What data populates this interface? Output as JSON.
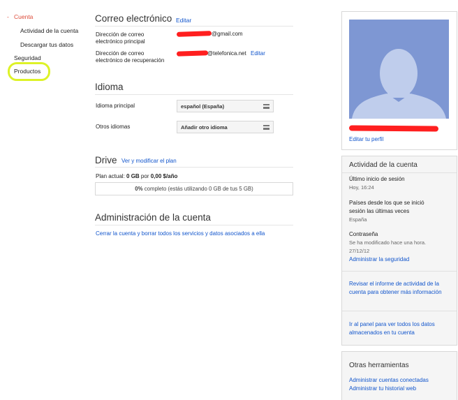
{
  "nav": {
    "account_bullet": "-",
    "account": "Cuenta",
    "activity": "Actividad de la cuenta",
    "download": "Descargar tus datos",
    "security": "Seguridad",
    "products": "Productos"
  },
  "email": {
    "title": "Correo electrónico",
    "edit_label": "Editar",
    "primary_label_1": "Dirección de correo",
    "primary_label_2": "electrónico principal",
    "primary_value": "@gmail.com",
    "recovery_label_1": "Dirección de correo",
    "recovery_label_2": "electrónico de recuperación",
    "recovery_value": "@telefonica.net",
    "recovery_edit": "Editar"
  },
  "language": {
    "title": "Idioma",
    "primary_label": "Idioma principal",
    "primary_value": "español (España)",
    "other_label": "Otros idiomas",
    "other_value": "Añadir otro idioma"
  },
  "drive": {
    "title": "Drive",
    "view_link": "Ver y modificar el plan",
    "plan_prefix": "Plan actual: ",
    "plan_gb": "0 GB",
    "plan_por": " por ",
    "plan_price": "0,00 $/año",
    "progress_pct": "0%",
    "progress_text": " completo (estás utilizando 0 GB de tus 5 GB)",
    "progress_fraction": 0
  },
  "admin": {
    "title": "Administración de la cuenta",
    "close_link": "Cerrar la cuenta y borrar todos los servicios y datos asociados a ella"
  },
  "profile": {
    "edit_link": "Editar tu perfil"
  },
  "activity": {
    "title": "Actividad de la cuenta",
    "last_login_label": "Último inicio de sesión",
    "last_login_value": "Hoy, 16:24",
    "countries_label_1": "Países desde los que se inició",
    "countries_label_2": "sesión las últimas veces",
    "countries_value": "España",
    "password_label": "Contraseña",
    "password_value_1": "Se ha modificado hace una hora.",
    "password_value_2": "27/12/12",
    "security_link": "Administrar la seguridad",
    "report_link": "Revisar el informe de actividad de la cuenta para obtener más información",
    "panel_link": "Ir al panel para ver todos los datos almacenados en tu cuenta"
  },
  "tools": {
    "title": "Otras herramientas",
    "connected_link": "Administrar cuentas conectadas",
    "history_link": "Administrar tu historial web"
  },
  "colors": {
    "link": "#1155cc",
    "active_nav": "#dd4b39",
    "highlight": "#ddf227",
    "redaction": "#ff1f1f",
    "avatar_bg": "#7e97d3"
  }
}
